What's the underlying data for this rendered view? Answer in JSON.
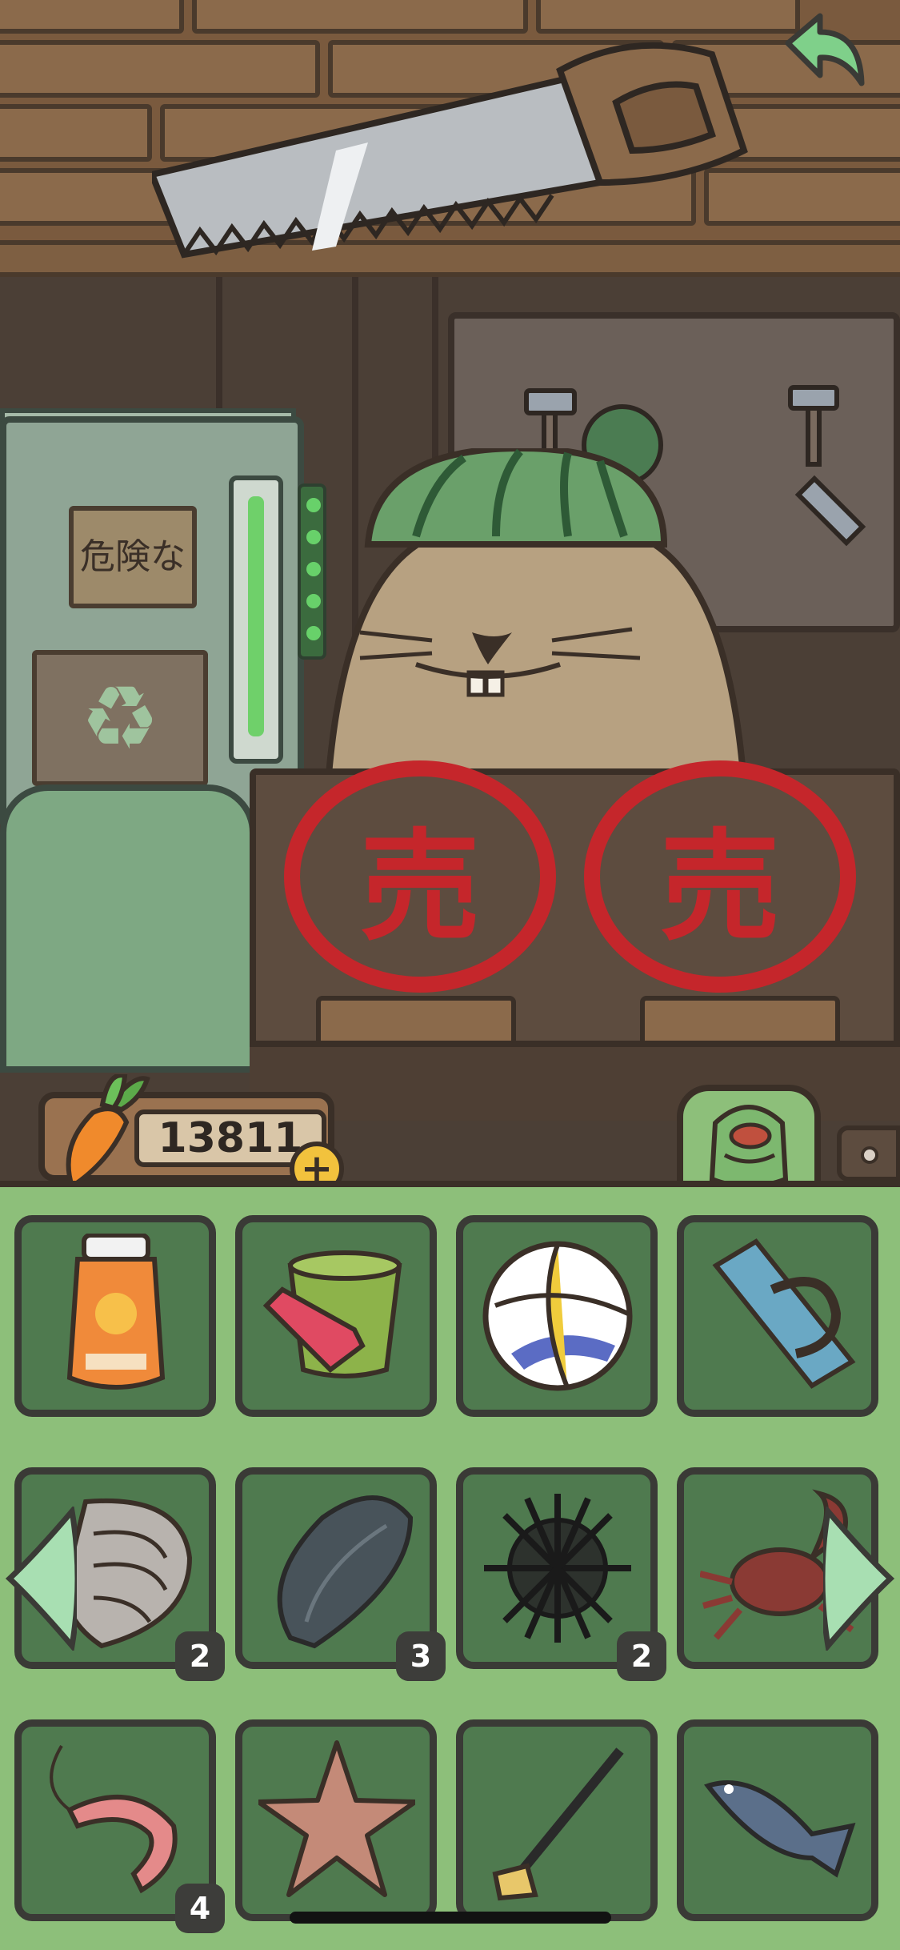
{
  "scene": {
    "sign_text": "危険な",
    "recycle_symbol": "♻",
    "stamp_char": "売",
    "sold_out_stamps": [
      "売",
      "売"
    ]
  },
  "currency": {
    "carrots": "13811",
    "add_symbol": "+"
  },
  "inventory": {
    "row1": [
      {
        "icon": "sunscreen-icon",
        "count": ""
      },
      {
        "icon": "sand-bucket-icon",
        "count": ""
      },
      {
        "icon": "volleyball-icon",
        "count": ""
      },
      {
        "icon": "beach-mat-icon",
        "count": ""
      }
    ],
    "row2": [
      {
        "icon": "oyster-icon",
        "count": "2"
      },
      {
        "icon": "mussel-icon",
        "count": "3"
      },
      {
        "icon": "sea-urchin-icon",
        "count": "2"
      },
      {
        "icon": "crab-icon",
        "count": ""
      }
    ],
    "row3": [
      {
        "icon": "shrimp-icon",
        "count": "4"
      },
      {
        "icon": "starfish-icon",
        "count": ""
      },
      {
        "icon": "garden-hoe-icon",
        "count": ""
      },
      {
        "icon": "fish-icon",
        "count": ""
      }
    ]
  },
  "colors": {
    "panel": "#8dbf7a",
    "slot": "#4f7a4f",
    "stamp": "#c5262b",
    "badge": "#3d3d3a"
  }
}
